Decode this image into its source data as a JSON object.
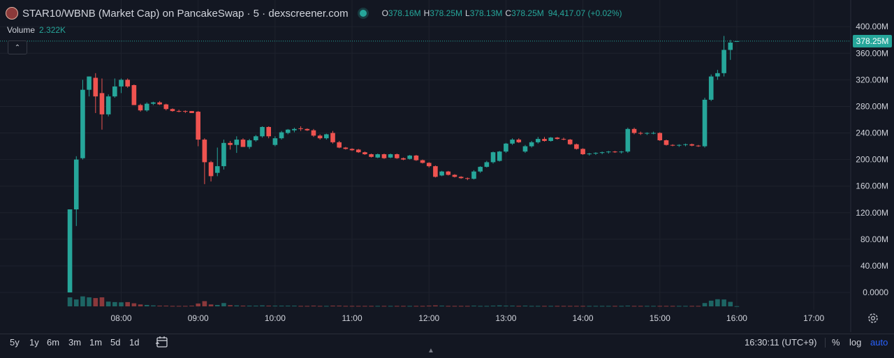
{
  "header": {
    "title": "STAR10/WBNB (Market Cap) on PancakeSwap · 5 · dexscreener.com",
    "ohlc": [
      {
        "key": "O",
        "value": "378.16M"
      },
      {
        "key": "H",
        "value": "378.25M"
      },
      {
        "key": "L",
        "value": "378.13M"
      },
      {
        "key": "C",
        "value": "378.25M"
      }
    ],
    "change": "94,417.07 (+0.02%)"
  },
  "volume": {
    "label": "Volume",
    "value": "2.322K"
  },
  "collapse_glyph": "⌃",
  "last_price_label": "378.25M",
  "colors": {
    "up": "#26a69a",
    "down": "#ef5350",
    "background": "#131722",
    "grid": "#1e222d",
    "accent": "#2962ff"
  },
  "toolbar": {
    "timeframes": [
      "5y",
      "1y",
      "6m",
      "3m",
      "1m",
      "5d",
      "1d"
    ],
    "clock": "16:30:11 (UTC+9)",
    "percent": "%",
    "log": "log",
    "auto": "auto"
  },
  "icons": [
    "avatar",
    "status-dot",
    "collapse-icon",
    "gear-icon",
    "date-range-icon",
    "scroll-up-icon"
  ],
  "chart_data": {
    "type": "candlestick",
    "title": "STAR10/WBNB (Market Cap) on PancakeSwap · 5 · dexscreener.com",
    "interval_minutes": 5,
    "y_ticks": [
      "400.00M",
      "360.00M",
      "320.00M",
      "280.00M",
      "240.00M",
      "200.00M",
      "160.00M",
      "120.00M",
      "80.00M",
      "40.00M",
      "0.0000"
    ],
    "y_tick_values": [
      400,
      360,
      320,
      280,
      240,
      200,
      160,
      120,
      80,
      40,
      0
    ],
    "ylim": [
      -22,
      417
    ],
    "x_ticks": [
      "08:00",
      "09:00",
      "10:00",
      "11:00",
      "12:00",
      "13:00",
      "14:00",
      "15:00",
      "16:00",
      "17:00"
    ],
    "x_tick_values": [
      480,
      540,
      600,
      660,
      720,
      780,
      840,
      900,
      960,
      1020
    ],
    "xlim": [
      385.5,
      1048.8
    ],
    "grid": true,
    "volume_ylim": [
      0,
      100
    ],
    "candles": [
      [
        440,
        0,
        125,
        0,
        125,
        38
      ],
      [
        445,
        125,
        205,
        100,
        200,
        29
      ],
      [
        450,
        202,
        320,
        200,
        305,
        42
      ],
      [
        455,
        305,
        325,
        295,
        325,
        38
      ],
      [
        460,
        323,
        330,
        270,
        295,
        35
      ],
      [
        465,
        300,
        322,
        245,
        268,
        38
      ],
      [
        470,
        268,
        298,
        265,
        295,
        20
      ],
      [
        475,
        295,
        322,
        293,
        310,
        18
      ],
      [
        480,
        310,
        322,
        300,
        320,
        17
      ],
      [
        485,
        320,
        322,
        308,
        310,
        18
      ],
      [
        490,
        312,
        313,
        282,
        282,
        13
      ],
      [
        495,
        282,
        284,
        272,
        274,
        8
      ],
      [
        500,
        274,
        286,
        272,
        284,
        6
      ],
      [
        505,
        284,
        287,
        282,
        286,
        4
      ],
      [
        510,
        286,
        288,
        282,
        283,
        3
      ],
      [
        515,
        283,
        284,
        274,
        276,
        3
      ],
      [
        520,
        276,
        277,
        272,
        273,
        2
      ],
      [
        525,
        273,
        275,
        271,
        272,
        2
      ],
      [
        530,
        273,
        274,
        270,
        272,
        2
      ],
      [
        535,
        273,
        273,
        270,
        270,
        3
      ],
      [
        540,
        272,
        273,
        220,
        230,
        12
      ],
      [
        545,
        230,
        232,
        163,
        196,
        22
      ],
      [
        550,
        196,
        198,
        167,
        175,
        8
      ],
      [
        555,
        180,
        218,
        175,
        190,
        6
      ],
      [
        560,
        190,
        230,
        185,
        225,
        14
      ],
      [
        565,
        225,
        228,
        215,
        222,
        5
      ],
      [
        570,
        222,
        235,
        210,
        230,
        4
      ],
      [
        575,
        230,
        232,
        219,
        219,
        3
      ],
      [
        580,
        219,
        231,
        216,
        229,
        3
      ],
      [
        585,
        229,
        237,
        227,
        235,
        3
      ],
      [
        590,
        235,
        250,
        233,
        249,
        4
      ],
      [
        595,
        249,
        250,
        232,
        235,
        3
      ],
      [
        600,
        222,
        235,
        220,
        232,
        3
      ],
      [
        605,
        232,
        243,
        230,
        241,
        3
      ],
      [
        610,
        240,
        246,
        238,
        245,
        3
      ],
      [
        615,
        244,
        248,
        241,
        246,
        3
      ],
      [
        620,
        247,
        250,
        243,
        246,
        2
      ],
      [
        625,
        246,
        247,
        243,
        244,
        2
      ],
      [
        630,
        244,
        246,
        234,
        236,
        3
      ],
      [
        635,
        236,
        238,
        230,
        232,
        2
      ],
      [
        640,
        232,
        239,
        230,
        238,
        2
      ],
      [
        645,
        240,
        243,
        224,
        226,
        3
      ],
      [
        650,
        226,
        228,
        217,
        218,
        3
      ],
      [
        655,
        218,
        219,
        215,
        216,
        2
      ],
      [
        660,
        216,
        217,
        213,
        214,
        2
      ],
      [
        665,
        215,
        216,
        210,
        211,
        2
      ],
      [
        670,
        211,
        212,
        207,
        208,
        2
      ],
      [
        675,
        208,
        209,
        203,
        204,
        2
      ],
      [
        680,
        203,
        209,
        202,
        208,
        2
      ],
      [
        685,
        208,
        209,
        201,
        202,
        2
      ],
      [
        690,
        203,
        209,
        202,
        208,
        2
      ],
      [
        695,
        208,
        209,
        201,
        202,
        2
      ],
      [
        700,
        202,
        203,
        199,
        200,
        2
      ],
      [
        705,
        201,
        207,
        200,
        206,
        2
      ],
      [
        710,
        206,
        207,
        198,
        199,
        2
      ],
      [
        715,
        199,
        200,
        194,
        195,
        2
      ],
      [
        720,
        195,
        196,
        188,
        190,
        3
      ],
      [
        725,
        190,
        191,
        173,
        174,
        4
      ],
      [
        730,
        176,
        183,
        175,
        182,
        3
      ],
      [
        735,
        182,
        183,
        176,
        177,
        2
      ],
      [
        740,
        177,
        178,
        173,
        174,
        2
      ],
      [
        745,
        174,
        175,
        171,
        172,
        2
      ],
      [
        750,
        172,
        173,
        169,
        171,
        2
      ],
      [
        755,
        171,
        184,
        170,
        182,
        3
      ],
      [
        760,
        182,
        190,
        180,
        189,
        2
      ],
      [
        765,
        189,
        198,
        188,
        196,
        2
      ],
      [
        770,
        196,
        212,
        194,
        211,
        3
      ],
      [
        775,
        198,
        213,
        197,
        212,
        4
      ],
      [
        780,
        212,
        225,
        210,
        224,
        3
      ],
      [
        785,
        224,
        232,
        222,
        230,
        3
      ],
      [
        790,
        230,
        232,
        225,
        226,
        2
      ],
      [
        795,
        212,
        222,
        210,
        220,
        3
      ],
      [
        800,
        220,
        228,
        218,
        226,
        2
      ],
      [
        805,
        226,
        234,
        224,
        231,
        2
      ],
      [
        810,
        231,
        234,
        227,
        228,
        2
      ],
      [
        815,
        228,
        234,
        227,
        233,
        2
      ],
      [
        820,
        233,
        234,
        230,
        231,
        2
      ],
      [
        825,
        231,
        233,
        229,
        230,
        2
      ],
      [
        830,
        230,
        231,
        222,
        223,
        2
      ],
      [
        835,
        223,
        224,
        215,
        216,
        2
      ],
      [
        840,
        216,
        217,
        207,
        208,
        2
      ],
      [
        845,
        208,
        210,
        206,
        209,
        2
      ],
      [
        850,
        209,
        211,
        207,
        210,
        2
      ],
      [
        855,
        210,
        212,
        208,
        211,
        2
      ],
      [
        860,
        211,
        213,
        209,
        212,
        2
      ],
      [
        865,
        212,
        213,
        210,
        211,
        2
      ],
      [
        870,
        211,
        213,
        209,
        212,
        2
      ],
      [
        875,
        212,
        248,
        210,
        246,
        3
      ],
      [
        880,
        246,
        248,
        238,
        240,
        2
      ],
      [
        885,
        240,
        242,
        237,
        239,
        2
      ],
      [
        890,
        239,
        241,
        237,
        240,
        2
      ],
      [
        895,
        240,
        242,
        238,
        240,
        2
      ],
      [
        900,
        240,
        241,
        228,
        229,
        2
      ],
      [
        905,
        229,
        230,
        221,
        222,
        2
      ],
      [
        910,
        222,
        223,
        220,
        221,
        2
      ],
      [
        915,
        221,
        223,
        219,
        222,
        2
      ],
      [
        920,
        222,
        224,
        220,
        223,
        2
      ],
      [
        925,
        223,
        224,
        220,
        221,
        2
      ],
      [
        930,
        221,
        222,
        219,
        220,
        2
      ],
      [
        935,
        220,
        293,
        218,
        290,
        14
      ],
      [
        940,
        290,
        328,
        288,
        325,
        24
      ],
      [
        945,
        325,
        335,
        320,
        330,
        30
      ],
      [
        950,
        330,
        386,
        325,
        365,
        29
      ],
      [
        955,
        365,
        380,
        350,
        376,
        19
      ],
      [
        960,
        378.16,
        378.25,
        378.13,
        378.25,
        1
      ]
    ]
  }
}
